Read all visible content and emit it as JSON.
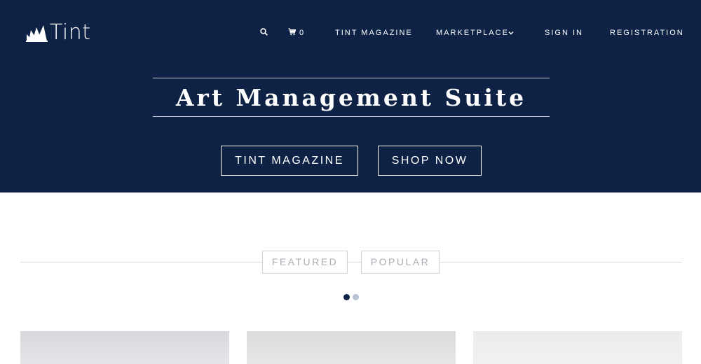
{
  "brand": {
    "name": "Tint"
  },
  "nav": {
    "cart_count": "0",
    "items": [
      "TINT MAGAZINE",
      "MARKETPLACE",
      "SIGN IN",
      "REGISTRATION"
    ]
  },
  "hero": {
    "title": "Art Management Suite",
    "buttons": [
      "TINT MAGAZINE",
      "SHOP NOW"
    ]
  },
  "tabs": [
    "FEATURED",
    "POPULAR"
  ],
  "carousel": {
    "active_index": 0,
    "count": 2
  },
  "colors": {
    "hero_bg": "#0d2244",
    "text_light": "#ffffff",
    "tab_text": "#a9adb3",
    "dot_active": "#0d2244",
    "dot_inactive": "#b7c3d3"
  },
  "icons": [
    "logo-mark-icon",
    "search-icon",
    "cart-icon",
    "chevron-down-icon"
  ]
}
